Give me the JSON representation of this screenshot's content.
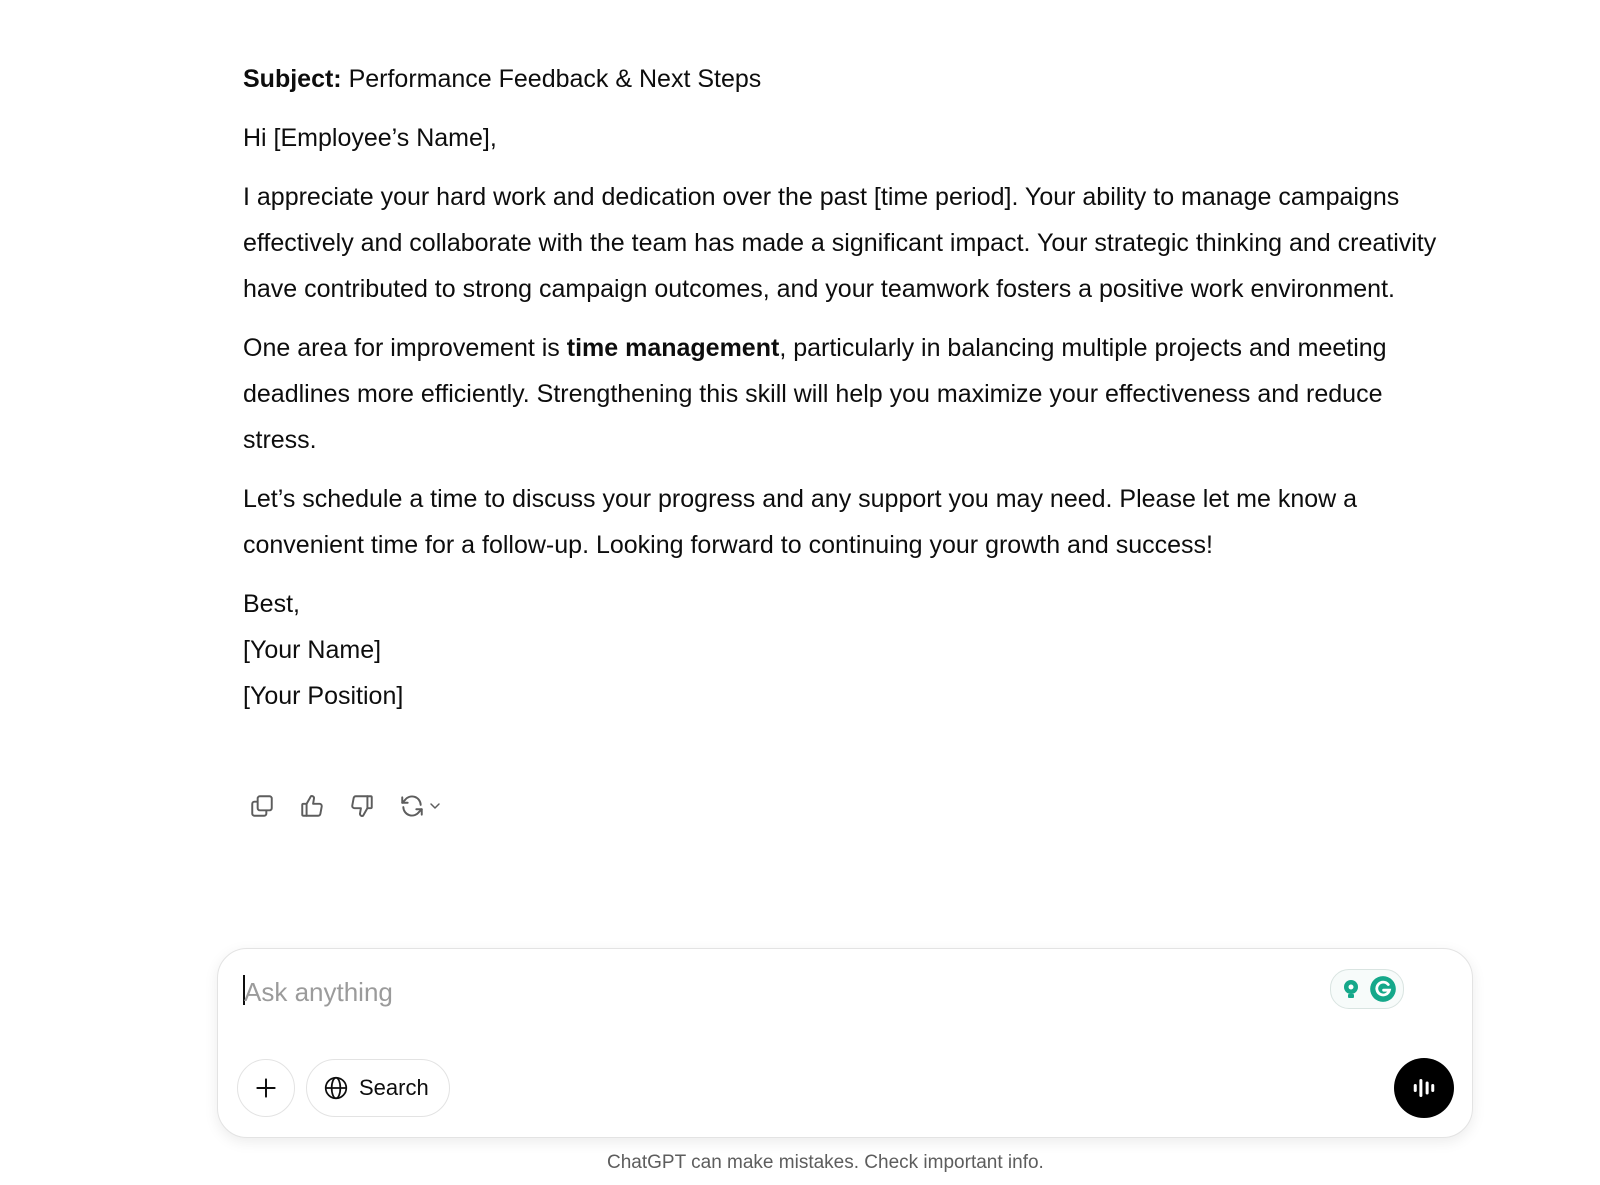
{
  "message": {
    "subject_label": "Subject:",
    "subject_text": " Performance Feedback & Next Steps",
    "greeting": "Hi [Employee’s Name],",
    "para1": "I appreciate your hard work and dedication over the past [time period]. Your ability to manage campaigns effectively and collaborate with the team has made a significant impact. Your strategic thinking and creativity have contributed to strong campaign outcomes, and your teamwork fosters a positive work environment.",
    "para2_before": "One area for improvement is ",
    "para2_bold": "time management",
    "para2_after": ", particularly in balancing multiple projects and meeting deadlines more efficiently. Strengthening this skill will help you maximize your effectiveness and reduce stress.",
    "para3": "Let’s schedule a time to discuss your progress and any support you may need. Please let me know a convenient time for a follow-up. Looking forward to continuing your growth and success!",
    "signoff": "Best,",
    "sign_name": "[Your Name]",
    "sign_position": "[Your Position]"
  },
  "actions": {
    "icons": [
      "copy-icon",
      "thumbs-up-icon",
      "thumbs-down-icon",
      "regenerate-icon",
      "chevron-down-icon"
    ]
  },
  "composer": {
    "placeholder": "Ask anything",
    "value": "",
    "search_label": "Search"
  },
  "footer": {
    "disclaimer": "ChatGPT can make mistakes. Check important info."
  },
  "colors": {
    "voice_button": "#000000",
    "grammarly": "#15c39a"
  }
}
